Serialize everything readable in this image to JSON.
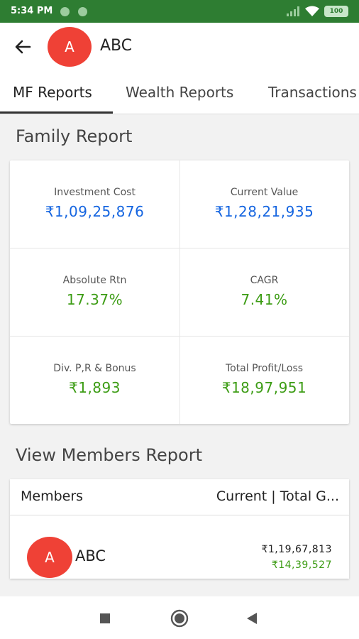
{
  "status_bar": {
    "time": "5:34 PM",
    "battery": "100"
  },
  "header": {
    "avatar_letter": "A",
    "title": "ABC"
  },
  "tabs": [
    {
      "label": "MF Reports",
      "active": true
    },
    {
      "label": "Wealth Reports",
      "active": false
    },
    {
      "label": "Transactions",
      "active": false
    }
  ],
  "family_report": {
    "title": "Family Report",
    "cells": [
      {
        "label": "Investment Cost",
        "value": "₹1,09,25,876",
        "color": "#1565e0"
      },
      {
        "label": "Current Value",
        "value": "₹1,28,21,935",
        "color": "#1565e0"
      },
      {
        "label": "Absolute Rtn",
        "value": "17.37%",
        "color": "#3c9c14"
      },
      {
        "label": "CAGR",
        "value": "7.41%",
        "color": "#3c9c14"
      },
      {
        "label": "Div. P,R & Bonus",
        "value": "₹1,893",
        "color": "#3c9c14"
      },
      {
        "label": "Total Profit/Loss",
        "value": "₹18,97,951",
        "color": "#3c9c14"
      }
    ]
  },
  "members_report": {
    "title": "View Members Report",
    "header_left": "Members",
    "header_right": "Current | Total G...",
    "rows": [
      {
        "avatar_letter": "A",
        "name": "ABC",
        "current": "₹1,19,67,813",
        "gain": "₹14,39,527"
      }
    ]
  },
  "nav_bar": {
    "buttons": [
      "recents-icon",
      "home-icon",
      "back-nav-icon"
    ]
  },
  "colors": {
    "brand_green": "#2e7d32",
    "avatar_red": "#ef4136",
    "blue": "#1565e0",
    "green": "#3c9c14"
  }
}
